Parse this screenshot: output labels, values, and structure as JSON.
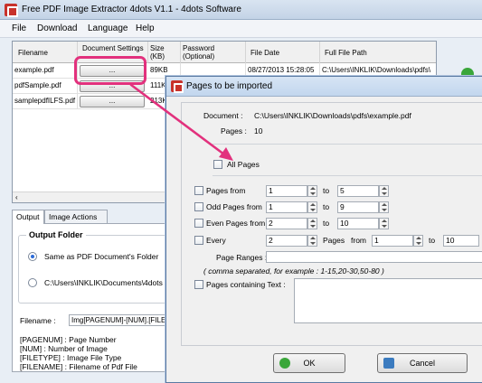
{
  "window": {
    "title": "Free PDF Image Extractor 4dots V1.1 - 4dots Software"
  },
  "menu": [
    "File",
    "Download",
    "Language",
    "Help"
  ],
  "grid": {
    "headers": [
      "Filename",
      "Document Settings",
      "Size (KB)",
      "Password (Optional)",
      "File Date",
      "Full File Path"
    ],
    "rows": [
      {
        "filename": "example.pdf",
        "button": "...",
        "size": "89KB",
        "date": "08/27/2013 15:28:05",
        "path": "C:\\Users\\INKLIK\\Downloads\\pdfs\\"
      },
      {
        "filename": "pdfSample.pdf",
        "button": "...",
        "size": "111KB",
        "date": "",
        "path": ""
      },
      {
        "filename": "samplepdfILFS.pdf",
        "button": "...",
        "size": "213KB",
        "date": "",
        "path": ""
      }
    ],
    "scroll_arrow": "‹"
  },
  "tabs": [
    "Output",
    "Image Actions"
  ],
  "output": {
    "group_label": "Output Folder",
    "option1": "Same as PDF Document's Folder",
    "option2": "C:\\Users\\INKLIK\\Documents\\4dots",
    "filename_label": "Filename :",
    "filename_value": "Img[PAGENUM]-[NUM].[FILET",
    "legend": [
      "[PAGENUM] : Page Number",
      "[NUM] : Number of Image",
      "[FILETYPE] : Image File Type",
      "[FILENAME] : Filename of Pdf File"
    ]
  },
  "dialog": {
    "title": "Pages to be imported",
    "document_label": "Document :",
    "document_value": "C:\\Users\\INKLIK\\Downloads\\pdfs\\example.pdf",
    "pages_label": "Pages :",
    "pages_value": "10",
    "all_pages": "All Pages",
    "pages_from": {
      "label": "Pages from",
      "from": "1",
      "to_label": "to",
      "to": "5"
    },
    "odd_pages": {
      "label": "Odd Pages from",
      "from": "1",
      "to_label": "to",
      "to": "9"
    },
    "even_pages": {
      "label": "Even Pages from",
      "from": "2",
      "to_label": "to",
      "to": "10"
    },
    "every": {
      "label": "Every",
      "value": "2",
      "pages_label": "Pages",
      "from_label": "from",
      "from": "1",
      "to_label": "to",
      "to": "10"
    },
    "page_ranges_label": "Page Ranges :",
    "page_ranges_hint": "( comma separated, for example : 1-15,20-30,50-80 )",
    "containing_text_label": "Pages containing Text :",
    "ok": "OK",
    "cancel": "Cancel"
  },
  "colors": {
    "highlight": "#e2317d",
    "arrow": "#e2317d"
  }
}
